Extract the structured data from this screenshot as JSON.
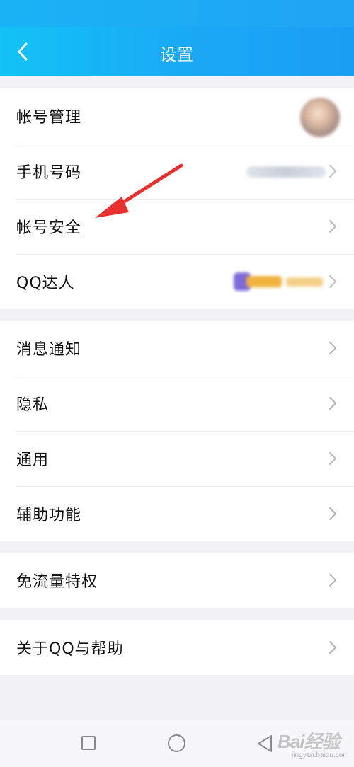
{
  "header": {
    "title": "设置",
    "back_icon": "chevron-left-icon",
    "colors": {
      "start": "#12c3f6",
      "end": "#1a9ef4"
    }
  },
  "groups": [
    {
      "rows": [
        {
          "label": "帐号管理",
          "trailing": "avatar"
        },
        {
          "label": "手机号码",
          "trailing": "blurred-phone-number"
        },
        {
          "label": "帐号安全",
          "trailing": "chevron-right-icon"
        },
        {
          "label": "QQ达人",
          "trailing": "vip-badge"
        }
      ]
    },
    {
      "rows": [
        {
          "label": "消息通知",
          "trailing": "chevron-right-icon"
        },
        {
          "label": "隐私",
          "trailing": "chevron-right-icon"
        },
        {
          "label": "通用",
          "trailing": "chevron-right-icon"
        },
        {
          "label": "辅助功能",
          "trailing": "chevron-right-icon"
        }
      ]
    },
    {
      "rows": [
        {
          "label": "免流量特权",
          "trailing": "chevron-right-icon"
        }
      ]
    },
    {
      "rows": [
        {
          "label": "关于QQ与帮助",
          "trailing": "chevron-right-icon"
        }
      ]
    }
  ],
  "annotation": {
    "icon": "red-arrow-icon",
    "color": "#e8312f"
  },
  "nav_bar": {
    "icons": [
      "recent-apps-icon",
      "home-icon",
      "back-triangle-icon"
    ]
  },
  "watermark": {
    "logo": "Bai经验",
    "url": "jingyan.baidu.com"
  }
}
